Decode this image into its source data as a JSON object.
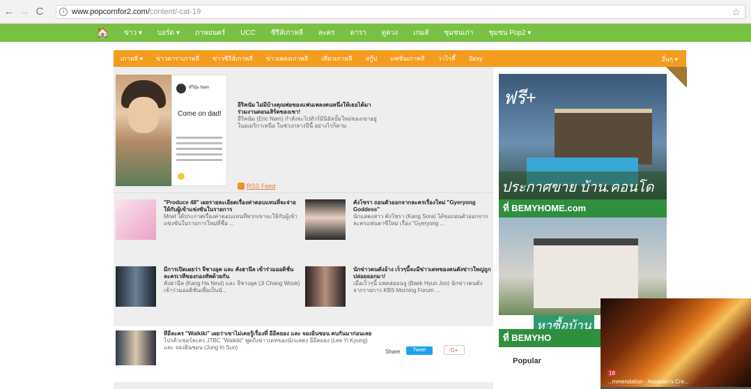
{
  "browser": {
    "url_host": "www.popcornfor2.com/",
    "url_path": "content/-cat-19",
    "info_glyph": "i",
    "back_glyph": "←",
    "forward_glyph": "→",
    "reload_glyph": "C",
    "star_glyph": "☆"
  },
  "topnav": {
    "home_glyph": "🏠",
    "items": [
      "ข่าว ▾",
      "บอร์ด ▾",
      "ภาพยนตร์",
      "UCC",
      "ซีรีส์เกาหลี",
      "ละคร",
      "ดารา",
      "ดูดวง",
      "เกมส์",
      "ชุมชนเก่า",
      "ชุมชน Pop2 ▾"
    ]
  },
  "subnav": {
    "items": [
      "เกาหลี ▾",
      "ข่าวดาราเกาหลี",
      "ข่าวซีรีส์เกาหลี",
      "ข่าวเพลงเกาหลี",
      "เที่ยวเกาหลี",
      "สกู๊ป",
      "แฟชั่นเกาหลี",
      "วาไรตี้",
      "Sexy"
    ],
    "more": "อื่นๆ ▾"
  },
  "feature": {
    "card_handle": "ทีวีอุ้ม Nam",
    "card_text": "Come on dad!",
    "title": "อีริคนัม ไม่มีบ้างคุณพ่อของแฟนเพลงคนหนึ่งให้เธอได้มาร่วมงานคอนเสิร์ตของเขา!",
    "desc": "อีริคนัม (Eric Nam) กำลังจะไปทัวร์มินิอัลบั้มใหม่ของเขาอยู่ในอเมริกาเหนือ ในช่วงกลางปีนี้ อย่างไรก็ตาม",
    "rss": "RSS Feed"
  },
  "items": [
    {
      "title": "\"Produce 48\" เผยรายละเอียดเรื่องค่าตอบแทนที่จะจ่ายให้กับผู้เข้าแข่งขันในรายการ",
      "desc": "Mnet ได้ประกาศเรื่องค่าตอบแทนที่พวกเขาจะให้กับผู้เข้าแข่งขันในรายการใหม่ที่ชื่อ ..."
    },
    {
      "title": "คังโซรา ถอนตัวออกจากละครเรื่องใหม่ \"Gyeryong Goddess\"",
      "desc": "นักแสดงสาว คังโซรา (Kang Sora) ได้ขอถอนตัวออกจากละครแฟนตาซีใหม่ เรื่อง \"Gyeryong ..."
    },
    {
      "title": "มีการเปิดเผยว่า จีชางอุค และ คังฮานึล เข้าร่วมออดิชั่นละครเวทีของกองทัพด้วยกัน",
      "desc": "คังฮานึล (Kang Ha Neul) และ จีชางอุค (Ji Chang Wook) เข้าร่วมออดิชั่นเพื่อเป็นนั..."
    },
    {
      "title": "นักข่าวคนดังอ้าง เร็วๆนี้จะมีข่าวเดทของคนดังข่าวใหญ่ถูกปล่อยออกมา!",
      "desc": "เมื่อเร็วๆนี้ แพคฮยอนจู (Baek Hyun Joo) นักข่าวคนดังจากรายการ KBS Morning Forum ..."
    }
  ],
  "bottom": {
    "title": "ทีอีละคร \"Waikiki\" เผยว่าเขาไม่เคยรู้เรื่องที่ อีอีคยอง และ จองอินซอน คบกันมาก่อนเลย",
    "desc": "โปรดิวเซอร์ละคร JTBC \"Waikiki\" พูดถึงข่าวเดทของนักแสดง อีอีคยอง (Lee Yi Kyung) และ จองอินซอน (Jung In Sun)",
    "share": "Share",
    "tweet": "Tweet",
    "gplus": "G+"
  },
  "ad": {
    "free": "ฟรี+",
    "announce": "ประกาศขาย บ้าน.คอนโด",
    "brand": "ที่ BEMYHOME.com",
    "find": "หาซื้อบ้าน",
    "brand2": "ที่ BEMYHO"
  },
  "popular": "Popular",
  "video": {
    "badge": "18",
    "caption": "...mmendation - Assassin's Cre..."
  }
}
